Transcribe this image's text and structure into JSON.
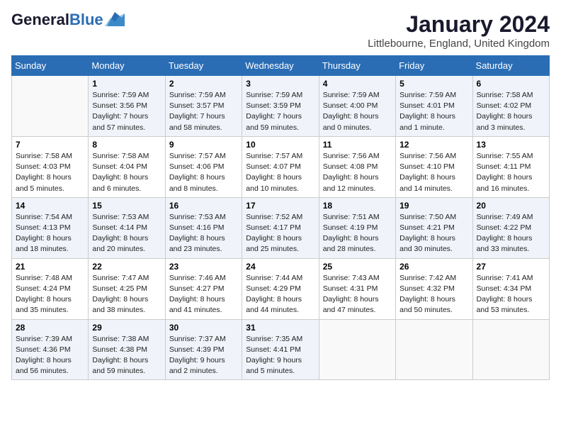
{
  "header": {
    "logo_general": "General",
    "logo_blue": "Blue",
    "month": "January 2024",
    "location": "Littlebourne, England, United Kingdom"
  },
  "days_of_week": [
    "Sunday",
    "Monday",
    "Tuesday",
    "Wednesday",
    "Thursday",
    "Friday",
    "Saturday"
  ],
  "weeks": [
    [
      {
        "day": "",
        "text": ""
      },
      {
        "day": "1",
        "text": "Sunrise: 7:59 AM\nSunset: 3:56 PM\nDaylight: 7 hours\nand 57 minutes."
      },
      {
        "day": "2",
        "text": "Sunrise: 7:59 AM\nSunset: 3:57 PM\nDaylight: 7 hours\nand 58 minutes."
      },
      {
        "day": "3",
        "text": "Sunrise: 7:59 AM\nSunset: 3:59 PM\nDaylight: 7 hours\nand 59 minutes."
      },
      {
        "day": "4",
        "text": "Sunrise: 7:59 AM\nSunset: 4:00 PM\nDaylight: 8 hours\nand 0 minutes."
      },
      {
        "day": "5",
        "text": "Sunrise: 7:59 AM\nSunset: 4:01 PM\nDaylight: 8 hours\nand 1 minute."
      },
      {
        "day": "6",
        "text": "Sunrise: 7:58 AM\nSunset: 4:02 PM\nDaylight: 8 hours\nand 3 minutes."
      }
    ],
    [
      {
        "day": "7",
        "text": "Sunrise: 7:58 AM\nSunset: 4:03 PM\nDaylight: 8 hours\nand 5 minutes."
      },
      {
        "day": "8",
        "text": "Sunrise: 7:58 AM\nSunset: 4:04 PM\nDaylight: 8 hours\nand 6 minutes."
      },
      {
        "day": "9",
        "text": "Sunrise: 7:57 AM\nSunset: 4:06 PM\nDaylight: 8 hours\nand 8 minutes."
      },
      {
        "day": "10",
        "text": "Sunrise: 7:57 AM\nSunset: 4:07 PM\nDaylight: 8 hours\nand 10 minutes."
      },
      {
        "day": "11",
        "text": "Sunrise: 7:56 AM\nSunset: 4:08 PM\nDaylight: 8 hours\nand 12 minutes."
      },
      {
        "day": "12",
        "text": "Sunrise: 7:56 AM\nSunset: 4:10 PM\nDaylight: 8 hours\nand 14 minutes."
      },
      {
        "day": "13",
        "text": "Sunrise: 7:55 AM\nSunset: 4:11 PM\nDaylight: 8 hours\nand 16 minutes."
      }
    ],
    [
      {
        "day": "14",
        "text": "Sunrise: 7:54 AM\nSunset: 4:13 PM\nDaylight: 8 hours\nand 18 minutes."
      },
      {
        "day": "15",
        "text": "Sunrise: 7:53 AM\nSunset: 4:14 PM\nDaylight: 8 hours\nand 20 minutes."
      },
      {
        "day": "16",
        "text": "Sunrise: 7:53 AM\nSunset: 4:16 PM\nDaylight: 8 hours\nand 23 minutes."
      },
      {
        "day": "17",
        "text": "Sunrise: 7:52 AM\nSunset: 4:17 PM\nDaylight: 8 hours\nand 25 minutes."
      },
      {
        "day": "18",
        "text": "Sunrise: 7:51 AM\nSunset: 4:19 PM\nDaylight: 8 hours\nand 28 minutes."
      },
      {
        "day": "19",
        "text": "Sunrise: 7:50 AM\nSunset: 4:21 PM\nDaylight: 8 hours\nand 30 minutes."
      },
      {
        "day": "20",
        "text": "Sunrise: 7:49 AM\nSunset: 4:22 PM\nDaylight: 8 hours\nand 33 minutes."
      }
    ],
    [
      {
        "day": "21",
        "text": "Sunrise: 7:48 AM\nSunset: 4:24 PM\nDaylight: 8 hours\nand 35 minutes."
      },
      {
        "day": "22",
        "text": "Sunrise: 7:47 AM\nSunset: 4:25 PM\nDaylight: 8 hours\nand 38 minutes."
      },
      {
        "day": "23",
        "text": "Sunrise: 7:46 AM\nSunset: 4:27 PM\nDaylight: 8 hours\nand 41 minutes."
      },
      {
        "day": "24",
        "text": "Sunrise: 7:44 AM\nSunset: 4:29 PM\nDaylight: 8 hours\nand 44 minutes."
      },
      {
        "day": "25",
        "text": "Sunrise: 7:43 AM\nSunset: 4:31 PM\nDaylight: 8 hours\nand 47 minutes."
      },
      {
        "day": "26",
        "text": "Sunrise: 7:42 AM\nSunset: 4:32 PM\nDaylight: 8 hours\nand 50 minutes."
      },
      {
        "day": "27",
        "text": "Sunrise: 7:41 AM\nSunset: 4:34 PM\nDaylight: 8 hours\nand 53 minutes."
      }
    ],
    [
      {
        "day": "28",
        "text": "Sunrise: 7:39 AM\nSunset: 4:36 PM\nDaylight: 8 hours\nand 56 minutes."
      },
      {
        "day": "29",
        "text": "Sunrise: 7:38 AM\nSunset: 4:38 PM\nDaylight: 8 hours\nand 59 minutes."
      },
      {
        "day": "30",
        "text": "Sunrise: 7:37 AM\nSunset: 4:39 PM\nDaylight: 9 hours\nand 2 minutes."
      },
      {
        "day": "31",
        "text": "Sunrise: 7:35 AM\nSunset: 4:41 PM\nDaylight: 9 hours\nand 5 minutes."
      },
      {
        "day": "",
        "text": ""
      },
      {
        "day": "",
        "text": ""
      },
      {
        "day": "",
        "text": ""
      }
    ]
  ]
}
